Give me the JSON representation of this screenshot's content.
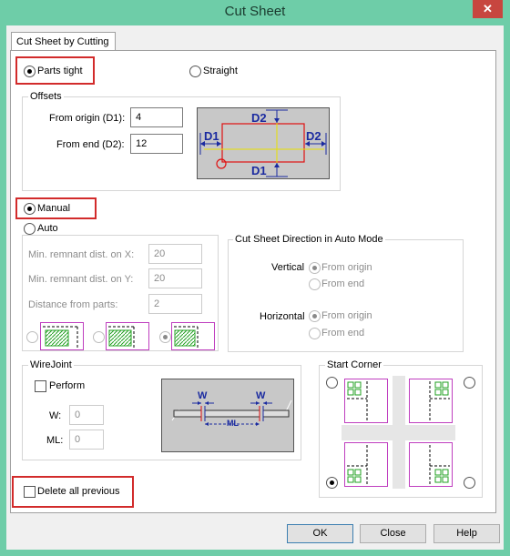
{
  "window": {
    "title": "Cut Sheet",
    "close_glyph": "✕"
  },
  "tab": {
    "label": "Cut Sheet by Cutting"
  },
  "placement": {
    "parts_tight": "Parts tight",
    "straight": "Straight",
    "selected": "parts_tight"
  },
  "offsets": {
    "title": "Offsets",
    "from_origin_label": "From origin (D1):",
    "from_origin_value": "4",
    "from_end_label": "From end (D2):",
    "from_end_value": "12",
    "diagram": {
      "d1": "D1",
      "d2": "D2"
    }
  },
  "mode": {
    "manual": "Manual",
    "auto": "Auto",
    "selected": "manual"
  },
  "auto_settings": {
    "min_remnant_x_label": "Min. remnant dist. on X:",
    "min_remnant_x_value": "20",
    "min_remnant_y_label": "Min. remnant dist. on Y:",
    "min_remnant_y_value": "20",
    "distance_label": "Distance from parts:",
    "distance_value": "2",
    "thumbnail_selected": 3
  },
  "direction": {
    "title": "Cut Sheet Direction in Auto Mode",
    "vertical_label": "Vertical",
    "horizontal_label": "Horizontal",
    "from_origin": "From origin",
    "from_end": "From end"
  },
  "wirejoint": {
    "title": "WireJoint",
    "perform_label": "Perform",
    "w_label": "W:",
    "w_value": "0",
    "ml_label": "ML:",
    "ml_value": "0",
    "diagram": {
      "w": "W",
      "ml": "ML"
    }
  },
  "start_corner": {
    "title": "Start Corner",
    "selected": "bottom-left"
  },
  "delete_all_previous": "Delete all previous",
  "buttons": {
    "ok": "OK",
    "close": "Close",
    "help": "Help"
  },
  "colors": {
    "highlight_red": "#d22b2b",
    "frame_green": "#6ecda8",
    "magenta": "#bf3ebf",
    "hatch_green": "#22a022"
  }
}
